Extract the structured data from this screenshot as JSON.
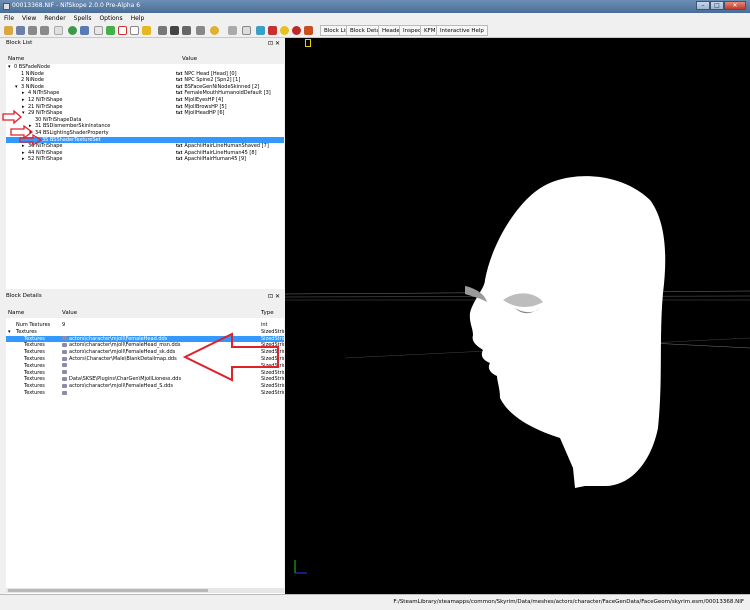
{
  "window": {
    "title": "00013368.NIF - NifSkope 2.0.0 Pre-Alpha 6"
  },
  "menu": [
    "File",
    "View",
    "Render",
    "Spells",
    "Options",
    "Help"
  ],
  "toolbar_tabs": [
    "Block List",
    "Block Details",
    "Header",
    "Inspect",
    "KFM",
    "Interactive Help"
  ],
  "block_list": {
    "title": "Block List",
    "columns": {
      "name": "Name",
      "value": "Value"
    },
    "rows": [
      {
        "name": "0 BSFadeNode",
        "value": "",
        "indent": 0,
        "arrow": "▾"
      },
      {
        "name": "1 NiNode",
        "value": "NPC Head [Head] [0]",
        "indent": 1
      },
      {
        "name": "2 NiNode",
        "value": "NPC Spine2 [Spn2] [1]",
        "indent": 1
      },
      {
        "name": "3 NiNode",
        "value": "BSFaceGenNiNodeSkinned [2]",
        "indent": 1,
        "arrow": "▾"
      },
      {
        "name": "4 NiTriShape",
        "value": "FemaleMouthHumanoidDefault [3]",
        "indent": 2,
        "arrow": "▸"
      },
      {
        "name": "12 NiTriShape",
        "value": "MjollEyesHP [4]",
        "indent": 2,
        "arrow": "▸"
      },
      {
        "name": "21 NiTriShape",
        "value": "MjollBrowsHP [5]",
        "indent": 2,
        "arrow": "▸"
      },
      {
        "name": "29 NiTriShape",
        "value": "MjollHeadHP [6]",
        "indent": 2,
        "arrow": "▾"
      },
      {
        "name": "30 NiTriShapeData",
        "value": "",
        "indent": 3
      },
      {
        "name": "31 BSDismemberSkinInstance",
        "value": "",
        "indent": 3,
        "arrow": "▸"
      },
      {
        "name": "34 BSLightingShaderProperty",
        "value": "",
        "indent": 3,
        "arrow": "▾"
      },
      {
        "name": "35 BSShaderTextureSet",
        "value": "",
        "indent": 4,
        "selected": true
      },
      {
        "name": "36 NiTriShape",
        "value": "ApachiiHairLineHumanShaved [7]",
        "indent": 2,
        "arrow": "▸"
      },
      {
        "name": "44 NiTriShape",
        "value": "ApachiiHairLineHuman45 [8]",
        "indent": 2,
        "arrow": "▸"
      },
      {
        "name": "52 NiTriShape",
        "value": "ApachiiHairHuman45 [9]",
        "indent": 2,
        "arrow": "▸"
      }
    ],
    "value_tag": "txt"
  },
  "block_details": {
    "title": "Block Details",
    "columns": {
      "name": "Name",
      "value": "Value",
      "type": "Type"
    },
    "rows": [
      {
        "name": "Num Textures",
        "value": "9",
        "type": "int",
        "indent": 0
      },
      {
        "name": "Textures",
        "value": "",
        "type": "SizedStrin",
        "indent": 0,
        "arrow": "▾"
      },
      {
        "name": "Textures",
        "value": "actors\\character\\mjoll\\FemaleHead.dds",
        "type": "SizedStrin",
        "indent": 1,
        "selected": true
      },
      {
        "name": "Textures",
        "value": "actors\\character\\mjoll\\FemaleHead_msn.dds",
        "type": "SizedStrin",
        "indent": 1
      },
      {
        "name": "Textures",
        "value": "actors\\character\\mjoll\\FemaleHead_sk.dds",
        "type": "SizedStrin",
        "indent": 1
      },
      {
        "name": "Textures",
        "value": "Actors\\Character\\Male\\BlankDetailmap.dds",
        "type": "SizedStrin",
        "indent": 1
      },
      {
        "name": "Textures",
        "value": "",
        "type": "SizedStrin",
        "indent": 1
      },
      {
        "name": "Textures",
        "value": "",
        "type": "SizedStrin",
        "indent": 1
      },
      {
        "name": "Textures",
        "value": "Data\\SKSE\\Plugins\\CharGen\\MjollLioness.dds",
        "type": "SizedStrin",
        "indent": 1
      },
      {
        "name": "Textures",
        "value": "actors\\character\\mjoll\\FemaleHead_S.dds",
        "type": "SizedStrin",
        "indent": 1
      },
      {
        "name": "Textures",
        "value": "",
        "type": "SizedStrin",
        "indent": 1
      }
    ]
  },
  "status": {
    "path": "F:/SteamLibrary/steamapps/common/Skyrim/Data/meshes/actors/character/FaceGenData/FaceGeom/skyrim.esm/00013368.NIF"
  },
  "colors": {
    "selection": "#3399ff",
    "viewport_bg": "#000000",
    "arrow_annotation": "#e0202a"
  }
}
